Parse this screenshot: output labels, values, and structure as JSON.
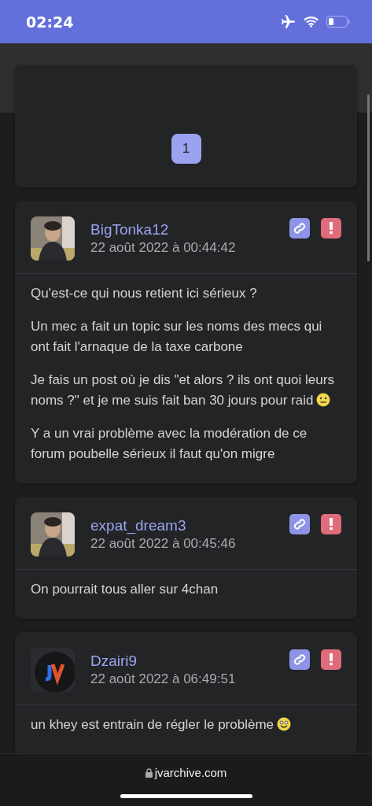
{
  "status_bar": {
    "time": "02:24"
  },
  "pagination": {
    "pages": [
      {
        "label": "1",
        "selected": true
      }
    ]
  },
  "posts": [
    {
      "author": "BigTonka12",
      "date": "22 août 2022 à 00:44:42",
      "paragraphs": [
        {
          "text": "Qu'est-ce qui nous retient ici sérieux ?"
        },
        {
          "text": "Un mec a fait un topic sur les noms des mecs qui ont fait l'arnaque de la taxe carbone"
        },
        {
          "text": "Je fais un post où je dis \"et alors ? ils ont quoi leurs noms ?\" et je me suis fait ban 30 jours pour raid",
          "emoji": {
            "kind": "neutral"
          }
        },
        {
          "text": "Y a un vrai problème avec la modération de ce forum poubelle sérieux il faut qu'on migre"
        }
      ]
    },
    {
      "author": "expat_dream3",
      "date": "22 août 2022 à 00:45:46",
      "paragraphs": [
        {
          "text": "On pourrait tous aller sur 4chan"
        }
      ]
    },
    {
      "author": "Dzairi9",
      "date": "22 août 2022 à 06:49:51",
      "avatar": {
        "kind": "logo"
      },
      "paragraphs": [
        {
          "text": "un khey est entrain de régler le problème",
          "emoji": {
            "kind": "smile"
          }
        }
      ]
    }
  ],
  "browser_bar": {
    "url": "jvarchive.com"
  }
}
